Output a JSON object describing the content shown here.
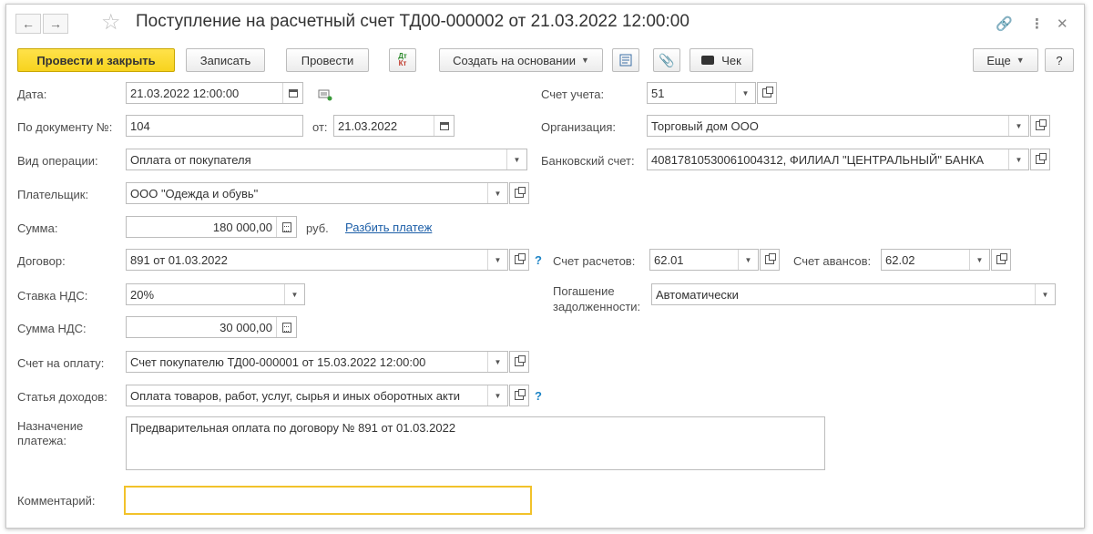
{
  "title": "Поступление на расчетный счет ТД00-000002 от 21.03.2022 12:00:00",
  "toolbar": {
    "post_and_close": "Провести и закрыть",
    "save": "Записать",
    "post": "Провести",
    "dt_kt_top": "Дт",
    "dt_kt_bottom": "Кт",
    "create_based_on": "Создать на основании",
    "receipt": "Чек",
    "more": "Еще",
    "help": "?"
  },
  "form": {
    "date_label": "Дата:",
    "date_value": "21.03.2022 12:00:00",
    "doc_no_label": "По документу №:",
    "doc_no_value": "104",
    "from_label": "от:",
    "from_value": "21.03.2022",
    "operation_label": "Вид операции:",
    "operation_value": "Оплата от покупателя",
    "payer_label": "Плательщик:",
    "payer_value": "ООО \"Одежда и обувь\"",
    "amount_label": "Сумма:",
    "amount_value": "180 000,00",
    "currency": "руб.",
    "split_payment_link": "Разбить платеж",
    "contract_label": "Договор:",
    "contract_value": "891 от 01.03.2022",
    "vat_rate_label": "Ставка НДС:",
    "vat_rate_value": "20%",
    "vat_amount_label": "Сумма НДС:",
    "vat_amount_value": "30 000,00",
    "invoice_label": "Счет на оплату:",
    "invoice_value": "Счет покупателю ТД00-000001 от 15.03.2022 12:00:00",
    "income_item_label": "Статья доходов:",
    "income_item_value": "Оплата товаров, работ, услуг, сырья и иных оборотных акти",
    "purpose_label_1": "Назначение",
    "purpose_label_2": "платежа:",
    "purpose_value": "Предварительная оплата по договору № 891 от 01.03.2022",
    "comment_label": "Комментарий:",
    "comment_value": "",
    "account_label": "Счет учета:",
    "account_value": "51",
    "organization_label": "Организация:",
    "organization_value": "Торговый дом ООО",
    "bank_account_label": "Банковский счет:",
    "bank_account_value": "40817810530061004312, ФИЛИАЛ \"ЦЕНТРАЛЬНЫЙ\" БАНКА",
    "settlement_account_label": "Счет расчетов:",
    "settlement_account_value": "62.01",
    "advance_account_label": "Счет авансов:",
    "advance_account_value": "62.02",
    "debt_repayment_label_1": "Погашение",
    "debt_repayment_label_2": "задолженности:",
    "debt_repayment_value": "Автоматически",
    "help_mark": "?"
  },
  "colors": {
    "primary_button": "#f7d31e",
    "link": "#1d5fa8",
    "help_mark": "#1d84c6",
    "focus_border": "#f2c22a"
  }
}
